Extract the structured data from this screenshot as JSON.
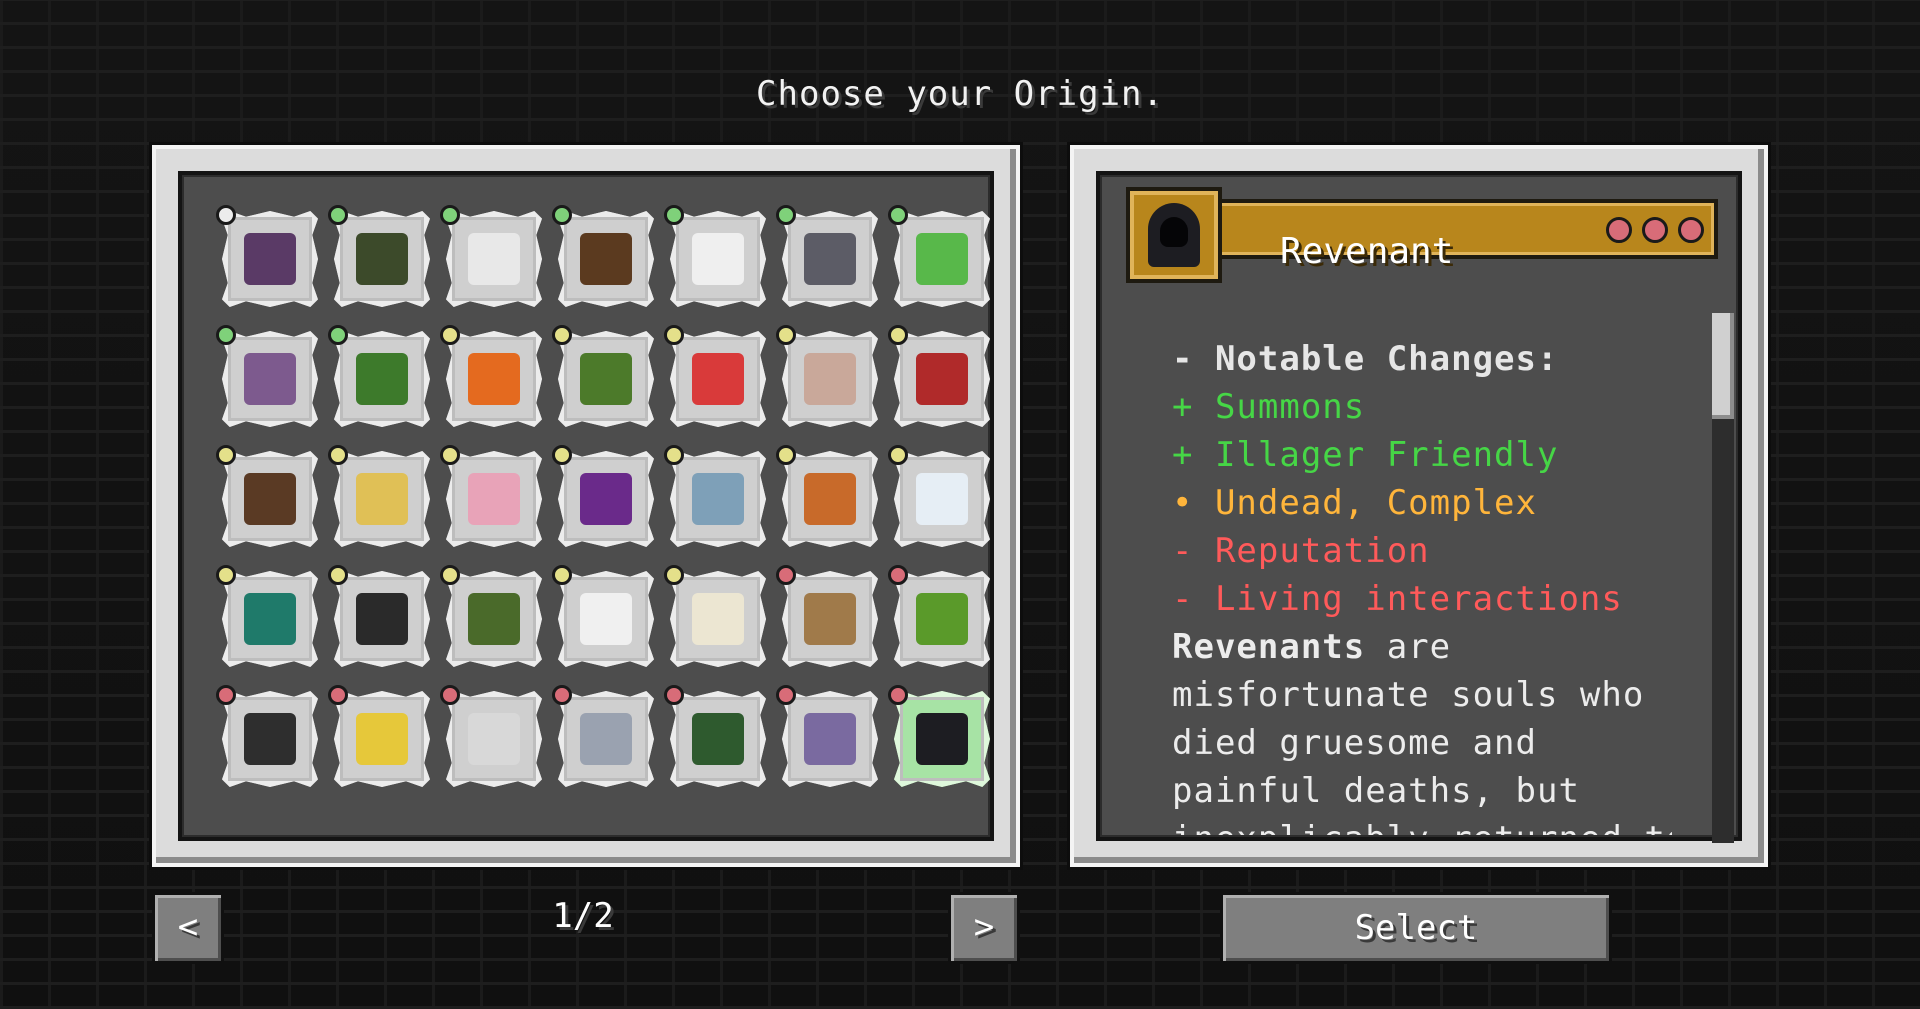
{
  "title": "Choose your Origin.",
  "grid": {
    "rows": [
      [
        {
          "icon": "purple-block-icon",
          "impact": "white",
          "color": "#5a3a66"
        },
        {
          "icon": "green-elf-face-icon",
          "impact": "green",
          "color": "#3c4a2a"
        },
        {
          "icon": "feather-icon",
          "impact": "green",
          "color": "#e8e8e8"
        },
        {
          "icon": "cat-person-face-icon",
          "impact": "green",
          "color": "#5b3a1f"
        },
        {
          "icon": "cobweb-icon",
          "impact": "green",
          "color": "#efefef"
        },
        {
          "icon": "elytra-icon",
          "impact": "green",
          "color": "#5c5c66"
        },
        {
          "icon": "green-orb-icon",
          "impact": "green",
          "color": "#58b84a"
        }
      ],
      [
        {
          "icon": "shulker-icon",
          "impact": "green",
          "color": "#7d5a8e"
        },
        {
          "icon": "goblin-face-icon",
          "impact": "green",
          "color": "#3d7a2b"
        },
        {
          "icon": "orange-block-icon",
          "impact": "yellow",
          "color": "#e46a1f"
        },
        {
          "icon": "sapling-icon",
          "impact": "yellow",
          "color": "#4c7a2a"
        },
        {
          "icon": "red-mushroom-icon",
          "impact": "yellow",
          "color": "#d93a3a"
        },
        {
          "icon": "pale-undead-face-icon",
          "impact": "yellow",
          "color": "#c9a89a"
        },
        {
          "icon": "red-demon-face-icon",
          "impact": "yellow",
          "color": "#b02a2a"
        }
      ],
      [
        {
          "icon": "bearded-man-face-icon",
          "impact": "yellow",
          "color": "#5a3a24"
        },
        {
          "icon": "blonde-elf-face-icon",
          "impact": "yellow",
          "color": "#e0c056"
        },
        {
          "icon": "pink-fairy-face-icon",
          "impact": "yellow",
          "color": "#e8a3b8"
        },
        {
          "icon": "purple-imp-face-icon",
          "impact": "yellow",
          "color": "#6a2a8a"
        },
        {
          "icon": "frost-spirit-face-icon",
          "impact": "yellow",
          "color": "#7ea0b8"
        },
        {
          "icon": "orange-haired-face-icon",
          "impact": "yellow",
          "color": "#c86a2a"
        },
        {
          "icon": "white-beast-face-icon",
          "impact": "yellow",
          "color": "#e6eef5"
        }
      ],
      [
        {
          "icon": "ender-pearl-icon",
          "impact": "yellow",
          "color": "#1f7a6a"
        },
        {
          "icon": "blackstone-block-icon",
          "impact": "yellow",
          "color": "#2a2a2a"
        },
        {
          "icon": "moss-block-icon",
          "impact": "yellow",
          "color": "#4a6a2a"
        },
        {
          "icon": "paper-icon",
          "impact": "yellow",
          "color": "#f0f0f0"
        },
        {
          "icon": "bone-icon",
          "impact": "yellow",
          "color": "#ece6d2"
        },
        {
          "icon": "cod-fish-icon",
          "impact": "red",
          "color": "#a07a4a"
        },
        {
          "icon": "pickle-icon",
          "impact": "red",
          "color": "#5a9a2a"
        }
      ],
      [
        {
          "icon": "anvil-icon",
          "impact": "red",
          "color": "#2e2e2e"
        },
        {
          "icon": "golden-sword-icon",
          "impact": "red",
          "color": "#e6c83a"
        },
        {
          "icon": "ghost-face-icon",
          "impact": "red",
          "color": "#d8d8d8"
        },
        {
          "icon": "silver-haired-face-icon",
          "impact": "red",
          "color": "#9aa2b0"
        },
        {
          "icon": "green-hooded-face-icon",
          "impact": "red",
          "color": "#2e5a2e"
        },
        {
          "icon": "purple-skinned-face-icon",
          "impact": "red",
          "color": "#7a6aa0"
        },
        {
          "icon": "hooded-revenant-face-icon",
          "impact": "red",
          "color": "#1d1d22",
          "selected": true
        }
      ]
    ]
  },
  "detail": {
    "name": "Revenant",
    "impact_count": 3,
    "lines": [
      {
        "text": "- Notable Changes:",
        "style": "head"
      },
      {
        "text": "+ Summons",
        "style": "green"
      },
      {
        "text": "+ Illager Friendly",
        "style": "green"
      },
      {
        "text": "• Undead, Complex",
        "style": "orange"
      },
      {
        "text": "- Reputation",
        "style": "red"
      },
      {
        "text": "- Living interactions",
        "style": "red"
      },
      {
        "bold": "Revenants",
        "text": " are",
        "style": "text"
      },
      {
        "text": "misfortunate souls who",
        "style": "text"
      },
      {
        "text": "died gruesome and",
        "style": "text"
      },
      {
        "text": "painful deaths, but",
        "style": "text"
      },
      {
        "text": "inexplicably returned to",
        "style": "text"
      }
    ]
  },
  "nav": {
    "prev_label": "<",
    "next_label": ">",
    "page": "1/2",
    "select_label": "Select"
  }
}
